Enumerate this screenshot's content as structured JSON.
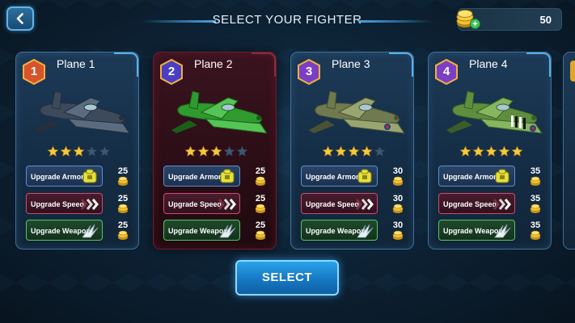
{
  "header": {
    "title": "SELECT YOUR FIGHTER",
    "coins": "50"
  },
  "colors": {
    "badge_1": "#d8532a",
    "badge_2": "#4a3fc4",
    "badge_3": "#7b3fc4",
    "badge_4": "#7b3fc4",
    "star_on": "#f5c842",
    "star_off": "#3d5770"
  },
  "upgrade_labels": {
    "armor": "Upgrade Armor",
    "speed": "Upgrade Speed",
    "weapon": "Upgrade Weapon"
  },
  "cards": [
    {
      "name": "Plane 1",
      "badge": "1",
      "stars": 3,
      "costs": {
        "armor": "25",
        "speed": "25",
        "weapon": "25"
      }
    },
    {
      "name": "Plane 2",
      "badge": "2",
      "stars": 3,
      "costs": {
        "armor": "25",
        "speed": "25",
        "weapon": "25"
      }
    },
    {
      "name": "Plane 3",
      "badge": "3",
      "stars": 4,
      "costs": {
        "armor": "30",
        "speed": "30",
        "weapon": "30"
      }
    },
    {
      "name": "Plane 4",
      "badge": "4",
      "stars": 5,
      "costs": {
        "armor": "35",
        "speed": "35",
        "weapon": "35"
      }
    }
  ],
  "select_label": "SELECT"
}
